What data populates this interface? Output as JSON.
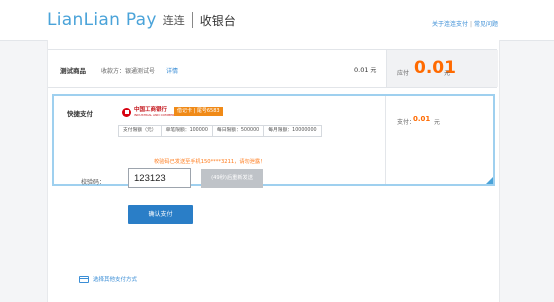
{
  "header": {
    "brand_name": "LianLian Pay",
    "brand_cn": "连连",
    "title": "收银台",
    "links": [
      "关于连连支付",
      "常见问题"
    ],
    "link_separator": "|"
  },
  "order": {
    "goods_name": "测试商品",
    "merchant": "收款方：银通测试号",
    "detail_link": "详情",
    "amount": "0.01",
    "amount_unit": "元",
    "pay_label": "应付",
    "pay_amount": "0.01",
    "pay_unit": "元"
  },
  "quick_pay": {
    "title": "快捷支付",
    "bank_name": "中国工商银行",
    "bank_name_en": "INDUSTRIAL AND COMMERCIAL BANK OF CHINA",
    "card_badge": "借记卡 | 尾号6583",
    "limits": [
      "支付限额（元）",
      "单笔限额：100000",
      "每日限额：500000",
      "每月限额：10000000"
    ],
    "pay_label": "支付：",
    "pay_amount": "0.01",
    "pay_unit": "元"
  },
  "verify": {
    "sms_hint": "校验码已发送至手机150****3211，请勿泄露！",
    "code_label": "校验码：",
    "code_value": "123123",
    "resend_label": "(49秒)后重新发送",
    "confirm_label": "确认支付"
  },
  "other_pay": {
    "label": "选择其他支付方式"
  },
  "colors": {
    "brand": "#4aa3d9",
    "accent_orange": "#ff6a00",
    "primary_button": "#2a7ec7",
    "link": "#3b8ed6"
  },
  "icons": {
    "bank_logo": "icbc-logo-icon",
    "other_pay": "card-icon",
    "panel_corner": "selected-corner-icon"
  }
}
